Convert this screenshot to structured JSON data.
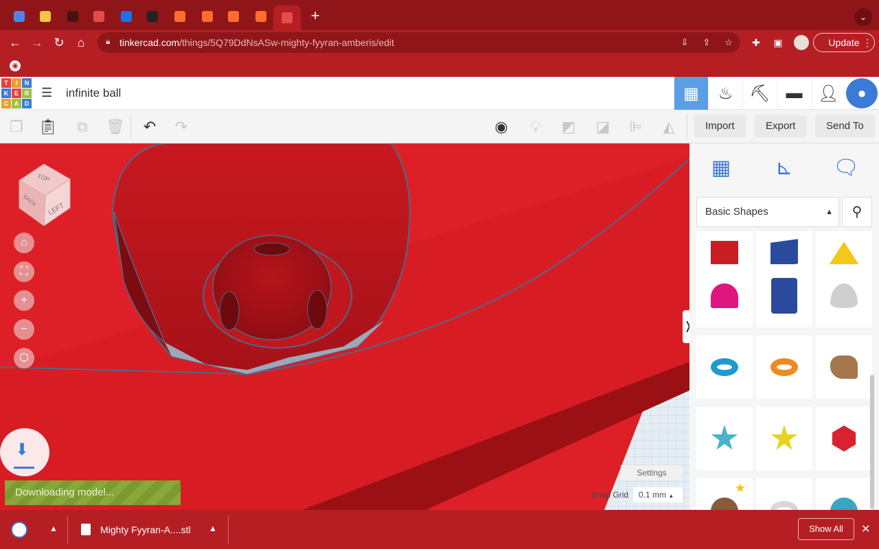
{
  "browser": {
    "tabs": [
      {
        "icon": "docs-icon",
        "color": "#4a86e8"
      },
      {
        "icon": "bulb-icon",
        "color": "#f4c542"
      },
      {
        "icon": "github-icon",
        "color": "#4a1113"
      },
      {
        "icon": "tinkercad-icon",
        "color": "#e54b4b"
      },
      {
        "icon": "t-icon",
        "color": "#1a73e8"
      },
      {
        "icon": "question-icon",
        "color": "#222222"
      },
      {
        "icon": "play-icon",
        "color": "#ff6d2e"
      },
      {
        "icon": "play-icon",
        "color": "#ff6d2e"
      },
      {
        "icon": "play-icon",
        "color": "#ff6d2e"
      },
      {
        "icon": "play-icon",
        "color": "#ff6d2e"
      },
      {
        "icon": "tinkercad-icon",
        "color": "#e54b4b"
      }
    ],
    "new_tab": "+",
    "url_host": "tinkercad.com",
    "url_path": "/things/5Q79DdNsASw-mighty-fyyran-amberis/edit",
    "update_label": "Update"
  },
  "tinkercad": {
    "logo_letters": [
      "T",
      "I",
      "N",
      "K",
      "E",
      "R",
      "C",
      "A",
      "D"
    ],
    "logo_colors": [
      "#e8413a",
      "#f29b2c",
      "#3b7bd6",
      "#3b7bd6",
      "#e8413a",
      "#9cc23c",
      "#f29b2c",
      "#9cc23c",
      "#3b7bd6"
    ],
    "project_title": "infinite ball",
    "toolbar": {
      "import_label": "Import",
      "export_label": "Export",
      "send_to_label": "Send To"
    },
    "viewcube": {
      "top": "TOP",
      "back": "BACK",
      "left": "LEFT"
    },
    "download": {
      "status": "Downloading model..."
    },
    "workplane": {
      "settings_label": "Settings",
      "snap_grid_label": "Snap Grid",
      "snap_grid_value": "0.1 mm"
    },
    "panel": {
      "shape_category": "Basic Shapes",
      "shapes": [
        {
          "name": "partial-red-shape",
          "color": "#c81f25"
        },
        {
          "name": "box-shape",
          "color": "#2a4a9e"
        },
        {
          "name": "pyramid-shape",
          "color": "#f2c81c"
        },
        {
          "name": "half-sphere-shape",
          "color": "#e0157f"
        },
        {
          "name": "polygon-shape",
          "color": "#2a4a9e"
        },
        {
          "name": "paraboloid-shape",
          "color": "#cfcfcf"
        },
        {
          "name": "torus-shape",
          "color": "#1e9ad0"
        },
        {
          "name": "tube-shape",
          "color": "#f08a1f"
        },
        {
          "name": "heart-shape",
          "color": "#a5774c"
        },
        {
          "name": "star-shape",
          "color": "#4bb3c8"
        },
        {
          "name": "star-shape-yellow",
          "color": "#e6d321"
        },
        {
          "name": "icosahedron-shape",
          "color": "#d92230"
        },
        {
          "name": "round-shape-brown",
          "color": "#8a5a3a"
        },
        {
          "name": "ring-shape-grey",
          "color": "#d8d8d8"
        },
        {
          "name": "dome-shape-teal",
          "color": "#3aa6c0"
        }
      ]
    }
  },
  "downloads": {
    "file_name": "Mighty Fyyran-A....stl",
    "show_all_label": "Show All"
  }
}
